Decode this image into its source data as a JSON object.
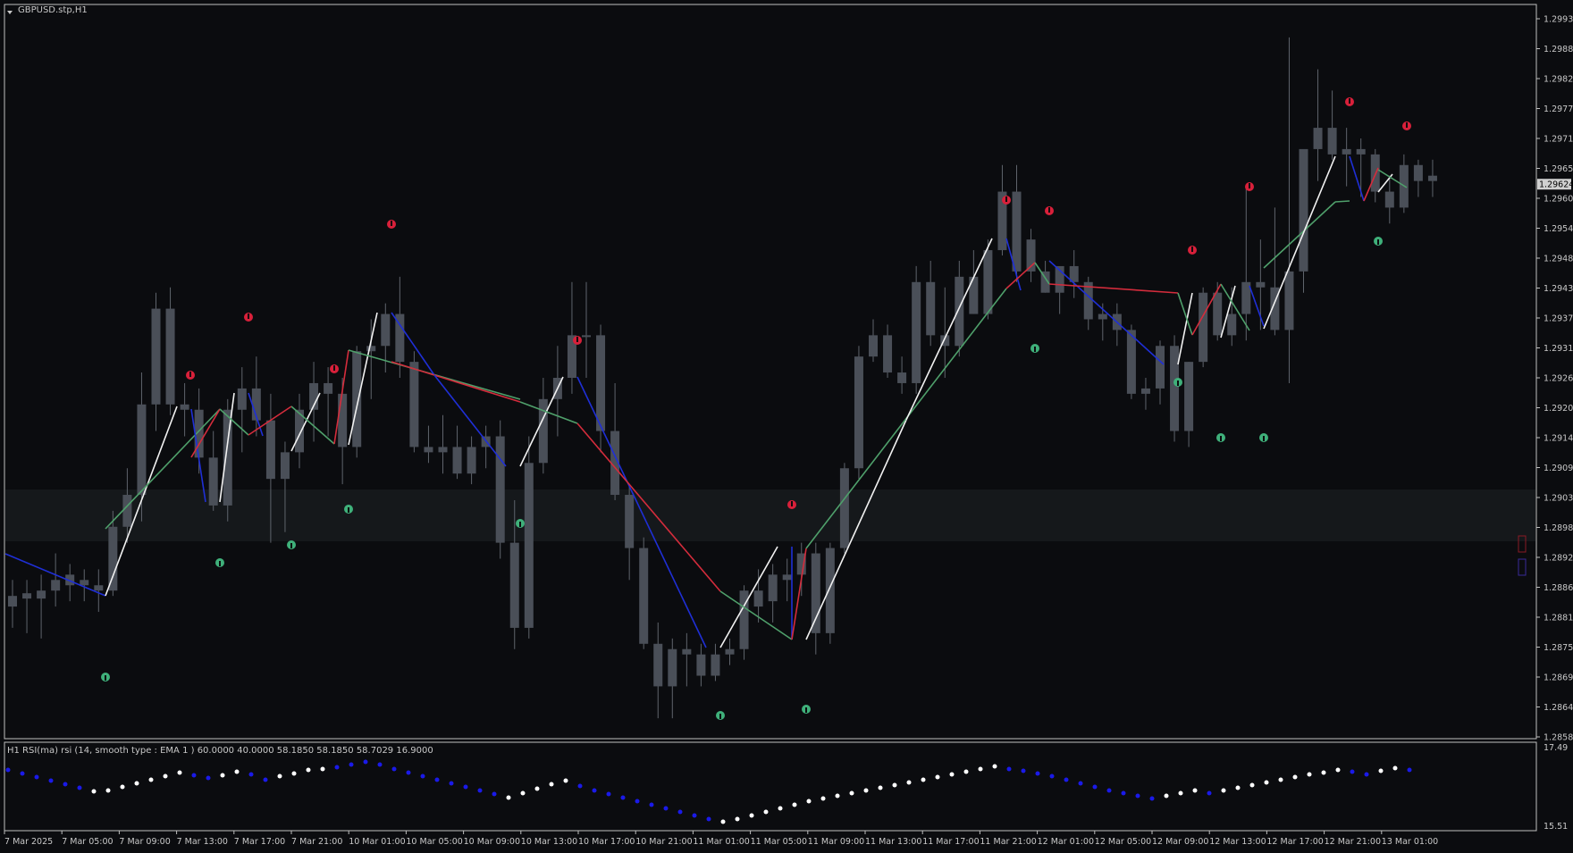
{
  "window": {
    "title": "GBPUSD.stp,H1",
    "collapse_icon": "triangle-down-icon"
  },
  "colors": {
    "background": "#0b0c0f",
    "frame": "#bfbfbf",
    "candle_body": "#4a4f58",
    "candle_wick": "#5f646c",
    "zigzag_blue": "#1f2fd6",
    "zigzag_red": "#d42c3c",
    "zigzag_green": "#4fa06b",
    "zigzag_white": "#f2f2f2",
    "arrow_red": "#d8203a",
    "arrow_green": "#3fb07a",
    "rsi_blue": "#1a1ae8",
    "rsi_white": "#ffffff",
    "band": "#15181b",
    "price_tag_bg": "#d0d0d0"
  },
  "price_axis": {
    "labels": [
      "1.29935",
      "1.29880",
      "1.29825",
      "1.29770",
      "1.29710",
      "1.29655",
      "1.29600",
      "1.29540",
      "1.29485",
      "1.29430",
      "1.29375",
      "1.29315",
      "1.29260",
      "1.29205",
      "1.29145",
      "1.29090",
      "1.29035",
      "1.28980",
      "1.28920",
      "1.28865",
      "1.28810",
      "1.28750",
      "1.28695",
      "1.28640",
      "1.28585"
    ],
    "current_price": "1.29624"
  },
  "rsi": {
    "label": "H1 RSI(ma) rsi (14, smooth type : EMA  1 ) 60.0000 40.0000 58.1850 58.1850 58.7029 16.9000",
    "axis_top": "17.49",
    "axis_bottom": "15.51"
  },
  "time_axis": {
    "labels": [
      "7 Mar 2025",
      "7 Mar 05:00",
      "7 Mar 09:00",
      "7 Mar 13:00",
      "7 Mar 17:00",
      "7 Mar 21:00",
      "10 Mar 01:00",
      "10 Mar 05:00",
      "10 Mar 09:00",
      "10 Mar 13:00",
      "10 Mar 17:00",
      "10 Mar 21:00",
      "11 Mar 01:00",
      "11 Mar 05:00",
      "11 Mar 09:00",
      "11 Mar 13:00",
      "11 Mar 17:00",
      "11 Mar 21:00",
      "12 Mar 01:00",
      "12 Mar 05:00",
      "12 Mar 09:00",
      "12 Mar 13:00",
      "12 Mar 17:00",
      "12 Mar 21:00",
      "13 Mar 01:00"
    ]
  },
  "chart_data": {
    "type": "candlestick",
    "symbol": "GBPUSD.stp",
    "timeframe": "H1",
    "ylim": [
      1.28585,
      1.29935
    ],
    "candles": [
      {
        "o": 1.2883,
        "h": 1.2888,
        "l": 1.2879,
        "c": 1.2885
      },
      {
        "o": 1.28845,
        "h": 1.2888,
        "l": 1.2878,
        "c": 1.28855
      },
      {
        "o": 1.28845,
        "h": 1.2889,
        "l": 1.2877,
        "c": 1.2886
      },
      {
        "o": 1.2886,
        "h": 1.2893,
        "l": 1.2883,
        "c": 1.2888
      },
      {
        "o": 1.2887,
        "h": 1.2891,
        "l": 1.2884,
        "c": 1.2889
      },
      {
        "o": 1.2888,
        "h": 1.289,
        "l": 1.2884,
        "c": 1.2887
      },
      {
        "o": 1.2886,
        "h": 1.289,
        "l": 1.2882,
        "c": 1.2887
      },
      {
        "o": 1.2886,
        "h": 1.2901,
        "l": 1.2885,
        "c": 1.2898
      },
      {
        "o": 1.2898,
        "h": 1.2909,
        "l": 1.2895,
        "c": 1.2904
      },
      {
        "o": 1.2904,
        "h": 1.2927,
        "l": 1.2899,
        "c": 1.2921
      },
      {
        "o": 1.2921,
        "h": 1.2942,
        "l": 1.2916,
        "c": 1.2939
      },
      {
        "o": 1.2939,
        "h": 1.2943,
        "l": 1.2919,
        "c": 1.2921
      },
      {
        "o": 1.2921,
        "h": 1.2925,
        "l": 1.2915,
        "c": 1.292
      },
      {
        "o": 1.292,
        "h": 1.2924,
        "l": 1.2908,
        "c": 1.2911
      },
      {
        "o": 1.2911,
        "h": 1.2916,
        "l": 1.2901,
        "c": 1.2902
      },
      {
        "o": 1.2902,
        "h": 1.2922,
        "l": 1.2899,
        "c": 1.292
      },
      {
        "o": 1.292,
        "h": 1.2928,
        "l": 1.2912,
        "c": 1.2924
      },
      {
        "o": 1.2924,
        "h": 1.293,
        "l": 1.2915,
        "c": 1.2918
      },
      {
        "o": 1.2918,
        "h": 1.2923,
        "l": 1.2895,
        "c": 1.2907
      },
      {
        "o": 1.2907,
        "h": 1.2914,
        "l": 1.2897,
        "c": 1.2912
      },
      {
        "o": 1.2912,
        "h": 1.2923,
        "l": 1.2909,
        "c": 1.292
      },
      {
        "o": 1.292,
        "h": 1.2929,
        "l": 1.2914,
        "c": 1.2925
      },
      {
        "o": 1.2925,
        "h": 1.2928,
        "l": 1.2915,
        "c": 1.2923
      },
      {
        "o": 1.2923,
        "h": 1.2926,
        "l": 1.2906,
        "c": 1.2913
      },
      {
        "o": 1.2913,
        "h": 1.2932,
        "l": 1.2911,
        "c": 1.2931
      },
      {
        "o": 1.2931,
        "h": 1.2937,
        "l": 1.2922,
        "c": 1.2932
      },
      {
        "o": 1.2932,
        "h": 1.294,
        "l": 1.2927,
        "c": 1.2938
      },
      {
        "o": 1.2938,
        "h": 1.2945,
        "l": 1.2926,
        "c": 1.2929
      },
      {
        "o": 1.2929,
        "h": 1.2931,
        "l": 1.2912,
        "c": 1.2913
      },
      {
        "o": 1.2913,
        "h": 1.2917,
        "l": 1.291,
        "c": 1.2912
      },
      {
        "o": 1.2912,
        "h": 1.2919,
        "l": 1.2908,
        "c": 1.2913
      },
      {
        "o": 1.2913,
        "h": 1.2917,
        "l": 1.2907,
        "c": 1.2908
      },
      {
        "o": 1.2908,
        "h": 1.2915,
        "l": 1.2906,
        "c": 1.2913
      },
      {
        "o": 1.2913,
        "h": 1.2917,
        "l": 1.2909,
        "c": 1.2915
      },
      {
        "o": 1.2915,
        "h": 1.2918,
        "l": 1.2892,
        "c": 1.2895
      },
      {
        "o": 1.2895,
        "h": 1.2903,
        "l": 1.2875,
        "c": 1.2879
      },
      {
        "o": 1.2879,
        "h": 1.2915,
        "l": 1.2877,
        "c": 1.291
      },
      {
        "o": 1.291,
        "h": 1.2926,
        "l": 1.2908,
        "c": 1.2922
      },
      {
        "o": 1.2922,
        "h": 1.2932,
        "l": 1.2915,
        "c": 1.2926
      },
      {
        "o": 1.2926,
        "h": 1.2944,
        "l": 1.2923,
        "c": 1.2934
      },
      {
        "o": 1.2934,
        "h": 1.2944,
        "l": 1.2926,
        "c": 1.2934
      },
      {
        "o": 1.2934,
        "h": 1.2936,
        "l": 1.2912,
        "c": 1.2916
      },
      {
        "o": 1.2916,
        "h": 1.2925,
        "l": 1.2903,
        "c": 1.2904
      },
      {
        "o": 1.2904,
        "h": 1.2906,
        "l": 1.2888,
        "c": 1.2894
      },
      {
        "o": 1.2894,
        "h": 1.2896,
        "l": 1.2875,
        "c": 1.2876
      },
      {
        "o": 1.2876,
        "h": 1.288,
        "l": 1.2862,
        "c": 1.2868
      },
      {
        "o": 1.2868,
        "h": 1.2877,
        "l": 1.2862,
        "c": 1.2875
      },
      {
        "o": 1.2875,
        "h": 1.2878,
        "l": 1.2868,
        "c": 1.2874
      },
      {
        "o": 1.2874,
        "h": 1.2876,
        "l": 1.2868,
        "c": 1.287
      },
      {
        "o": 1.287,
        "h": 1.2876,
        "l": 1.2869,
        "c": 1.2874
      },
      {
        "o": 1.2874,
        "h": 1.2877,
        "l": 1.2872,
        "c": 1.2875
      },
      {
        "o": 1.2875,
        "h": 1.2887,
        "l": 1.2873,
        "c": 1.2886
      },
      {
        "o": 1.2886,
        "h": 1.289,
        "l": 1.288,
        "c": 1.2883
      },
      {
        "o": 1.2884,
        "h": 1.2891,
        "l": 1.288,
        "c": 1.2889
      },
      {
        "o": 1.2888,
        "h": 1.2892,
        "l": 1.2884,
        "c": 1.2889
      },
      {
        "o": 1.2889,
        "h": 1.2895,
        "l": 1.2885,
        "c": 1.2893
      },
      {
        "o": 1.2893,
        "h": 1.2895,
        "l": 1.2874,
        "c": 1.2878
      },
      {
        "o": 1.2878,
        "h": 1.2895,
        "l": 1.2876,
        "c": 1.2894
      },
      {
        "o": 1.2894,
        "h": 1.291,
        "l": 1.2893,
        "c": 1.2909
      },
      {
        "o": 1.2909,
        "h": 1.2932,
        "l": 1.2907,
        "c": 1.293
      },
      {
        "o": 1.293,
        "h": 1.2937,
        "l": 1.2929,
        "c": 1.2934
      },
      {
        "o": 1.2934,
        "h": 1.2936,
        "l": 1.2926,
        "c": 1.2927
      },
      {
        "o": 1.2927,
        "h": 1.293,
        "l": 1.2923,
        "c": 1.2925
      },
      {
        "o": 1.2925,
        "h": 1.2947,
        "l": 1.2923,
        "c": 1.2944
      },
      {
        "o": 1.2944,
        "h": 1.2948,
        "l": 1.2932,
        "c": 1.2934
      },
      {
        "o": 1.2934,
        "h": 1.2943,
        "l": 1.2926,
        "c": 1.2932
      },
      {
        "o": 1.2932,
        "h": 1.2948,
        "l": 1.293,
        "c": 1.2945
      },
      {
        "o": 1.2945,
        "h": 1.295,
        "l": 1.2938,
        "c": 1.2938
      },
      {
        "o": 1.2938,
        "h": 1.2952,
        "l": 1.2937,
        "c": 1.295
      },
      {
        "o": 1.295,
        "h": 1.2966,
        "l": 1.2949,
        "c": 1.2961
      },
      {
        "o": 1.2961,
        "h": 1.2966,
        "l": 1.2944,
        "c": 1.2946
      },
      {
        "o": 1.2946,
        "h": 1.2954,
        "l": 1.2944,
        "c": 1.2952
      },
      {
        "o": 1.2946,
        "h": 1.2948,
        "l": 1.2942,
        "c": 1.2942
      },
      {
        "o": 1.2942,
        "h": 1.2946,
        "l": 1.2938,
        "c": 1.2947
      },
      {
        "o": 1.2947,
        "h": 1.295,
        "l": 1.2941,
        "c": 1.2944
      },
      {
        "o": 1.2944,
        "h": 1.2945,
        "l": 1.2935,
        "c": 1.2937
      },
      {
        "o": 1.2937,
        "h": 1.294,
        "l": 1.2933,
        "c": 1.2938
      },
      {
        "o": 1.2938,
        "h": 1.294,
        "l": 1.2932,
        "c": 1.2935
      },
      {
        "o": 1.2935,
        "h": 1.2936,
        "l": 1.2922,
        "c": 1.2923
      },
      {
        "o": 1.2923,
        "h": 1.2926,
        "l": 1.292,
        "c": 1.2924
      },
      {
        "o": 1.2924,
        "h": 1.2933,
        "l": 1.2921,
        "c": 1.2932
      },
      {
        "o": 1.2932,
        "h": 1.2934,
        "l": 1.2914,
        "c": 1.2916
      },
      {
        "o": 1.2916,
        "h": 1.2929,
        "l": 1.2913,
        "c": 1.2929
      },
      {
        "o": 1.2929,
        "h": 1.2943,
        "l": 1.2928,
        "c": 1.2942
      },
      {
        "o": 1.2942,
        "h": 1.2944,
        "l": 1.2933,
        "c": 1.2934
      },
      {
        "o": 1.2934,
        "h": 1.2943,
        "l": 1.2932,
        "c": 1.2938
      },
      {
        "o": 1.2938,
        "h": 1.2962,
        "l": 1.2933,
        "c": 1.2944
      },
      {
        "o": 1.2944,
        "h": 1.2952,
        "l": 1.2935,
        "c": 1.2943
      },
      {
        "o": 1.2943,
        "h": 1.2958,
        "l": 1.2934,
        "c": 1.2935
      },
      {
        "o": 1.2935,
        "h": 1.299,
        "l": 1.2925,
        "c": 1.2946
      },
      {
        "o": 1.2946,
        "h": 1.2959,
        "l": 1.2942,
        "c": 1.2969
      },
      {
        "o": 1.2969,
        "h": 1.2984,
        "l": 1.2963,
        "c": 1.2973
      },
      {
        "o": 1.2973,
        "h": 1.298,
        "l": 1.2967,
        "c": 1.2968
      },
      {
        "o": 1.2968,
        "h": 1.2973,
        "l": 1.2962,
        "c": 1.2969
      },
      {
        "o": 1.2969,
        "h": 1.2971,
        "l": 1.296,
        "c": 1.2968
      },
      {
        "o": 1.2968,
        "h": 1.2969,
        "l": 1.2959,
        "c": 1.2961
      },
      {
        "o": 1.2961,
        "h": 1.2964,
        "l": 1.2955,
        "c": 1.2958
      },
      {
        "o": 1.2958,
        "h": 1.2968,
        "l": 1.2957,
        "c": 1.2966
      },
      {
        "o": 1.2966,
        "h": 1.2967,
        "l": 1.296,
        "c": 1.2963
      },
      {
        "o": 1.2963,
        "h": 1.2967,
        "l": 1.296,
        "c": 1.2964
      }
    ]
  }
}
